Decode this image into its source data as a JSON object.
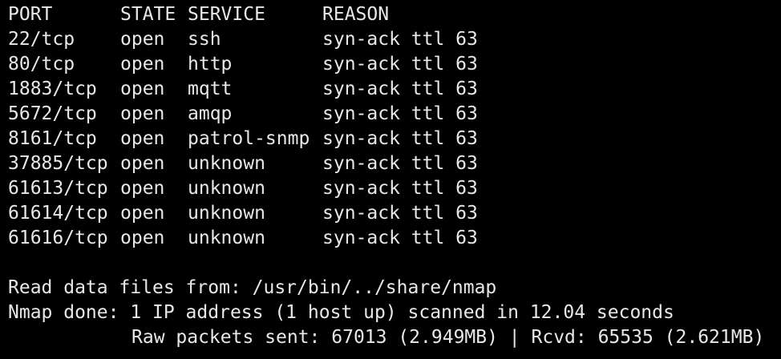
{
  "headers": {
    "port": "PORT",
    "state": "STATE",
    "service": "SERVICE",
    "reason": "REASON"
  },
  "rows": [
    {
      "port": "22/tcp",
      "state": "open",
      "service": "ssh",
      "reason": "syn-ack ttl 63"
    },
    {
      "port": "80/tcp",
      "state": "open",
      "service": "http",
      "reason": "syn-ack ttl 63"
    },
    {
      "port": "1883/tcp",
      "state": "open",
      "service": "mqtt",
      "reason": "syn-ack ttl 63"
    },
    {
      "port": "5672/tcp",
      "state": "open",
      "service": "amqp",
      "reason": "syn-ack ttl 63"
    },
    {
      "port": "8161/tcp",
      "state": "open",
      "service": "patrol-snmp",
      "reason": "syn-ack ttl 63"
    },
    {
      "port": "37885/tcp",
      "state": "open",
      "service": "unknown",
      "reason": "syn-ack ttl 63"
    },
    {
      "port": "61613/tcp",
      "state": "open",
      "service": "unknown",
      "reason": "syn-ack ttl 63"
    },
    {
      "port": "61614/tcp",
      "state": "open",
      "service": "unknown",
      "reason": "syn-ack ttl 63"
    },
    {
      "port": "61616/tcp",
      "state": "open",
      "service": "unknown",
      "reason": "syn-ack ttl 63"
    }
  ],
  "footer": {
    "read_data": "Read data files from: /usr/bin/../share/nmap",
    "done": "Nmap done: 1 IP address (1 host up) scanned in 12.04 seconds",
    "raw_packets": "Raw packets sent: 67013 (2.949MB) | Rcvd: 65535 (2.621MB)"
  },
  "colors": {
    "background": "#000000",
    "foreground": "#e8e8e8"
  }
}
